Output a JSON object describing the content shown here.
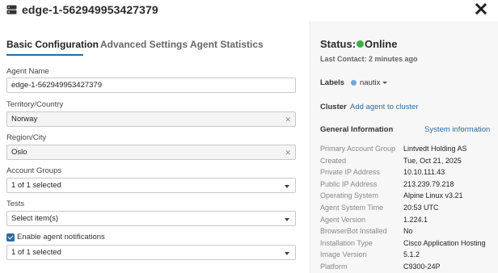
{
  "header": {
    "title": "edge-1-562949953427379"
  },
  "tabs": [
    {
      "label": "Basic Configuration",
      "active": true
    },
    {
      "label": "Advanced Settings",
      "active": false
    },
    {
      "label": "Agent Statistics",
      "active": false
    }
  ],
  "form": {
    "agent_name_label": "Agent Name",
    "agent_name_value": "edge-1-562949953427379",
    "territory_label": "Territory/Country",
    "territory_value": "Norway",
    "region_label": "Region/City",
    "region_value": "Oslo",
    "account_groups_label": "Account Groups",
    "account_groups_value": "1 of 1 selected",
    "tests_label": "Tests",
    "tests_value": "Select item(s)",
    "notifications_label": "Enable agent notifications",
    "notifications_checked": true,
    "notifications_value": "1 of 1 selected"
  },
  "status": {
    "label": "Status:",
    "value": "Online",
    "color": "#3cb043",
    "last_contact": "Last Contact: 2 minutes ago"
  },
  "labels": {
    "title": "Labels",
    "tag": "nautix",
    "tag_color": "#6fa8dc"
  },
  "cluster": {
    "title": "Cluster",
    "link": "Add agent to cluster"
  },
  "general_info": {
    "title": "General Information",
    "link": "System information",
    "rows": [
      {
        "key": "Primary Account Group",
        "value": "Lintvedt Holding AS"
      },
      {
        "key": "Created",
        "value": "Tue, Oct 21, 2025"
      },
      {
        "key": "Private IP Address",
        "value": "10.10.111.43"
      },
      {
        "key": "Public IP Address",
        "value": "213.239.79.218"
      },
      {
        "key": "Operating System",
        "value": "Alpine Linux v3.21"
      },
      {
        "key": "Agent System Time",
        "value": "20:53 UTC"
      },
      {
        "key": "Agent Version",
        "value": "1.224.1"
      },
      {
        "key": "BrowserBot Installed",
        "value": "No"
      },
      {
        "key": "Installation Type",
        "value": "Cisco Application Hosting"
      },
      {
        "key": "Image Version",
        "value": "5.1.2"
      },
      {
        "key": "Platform",
        "value": "C9300-24P"
      }
    ]
  },
  "colors": {
    "accent": "#2c6aa0",
    "online": "#3cb043"
  }
}
